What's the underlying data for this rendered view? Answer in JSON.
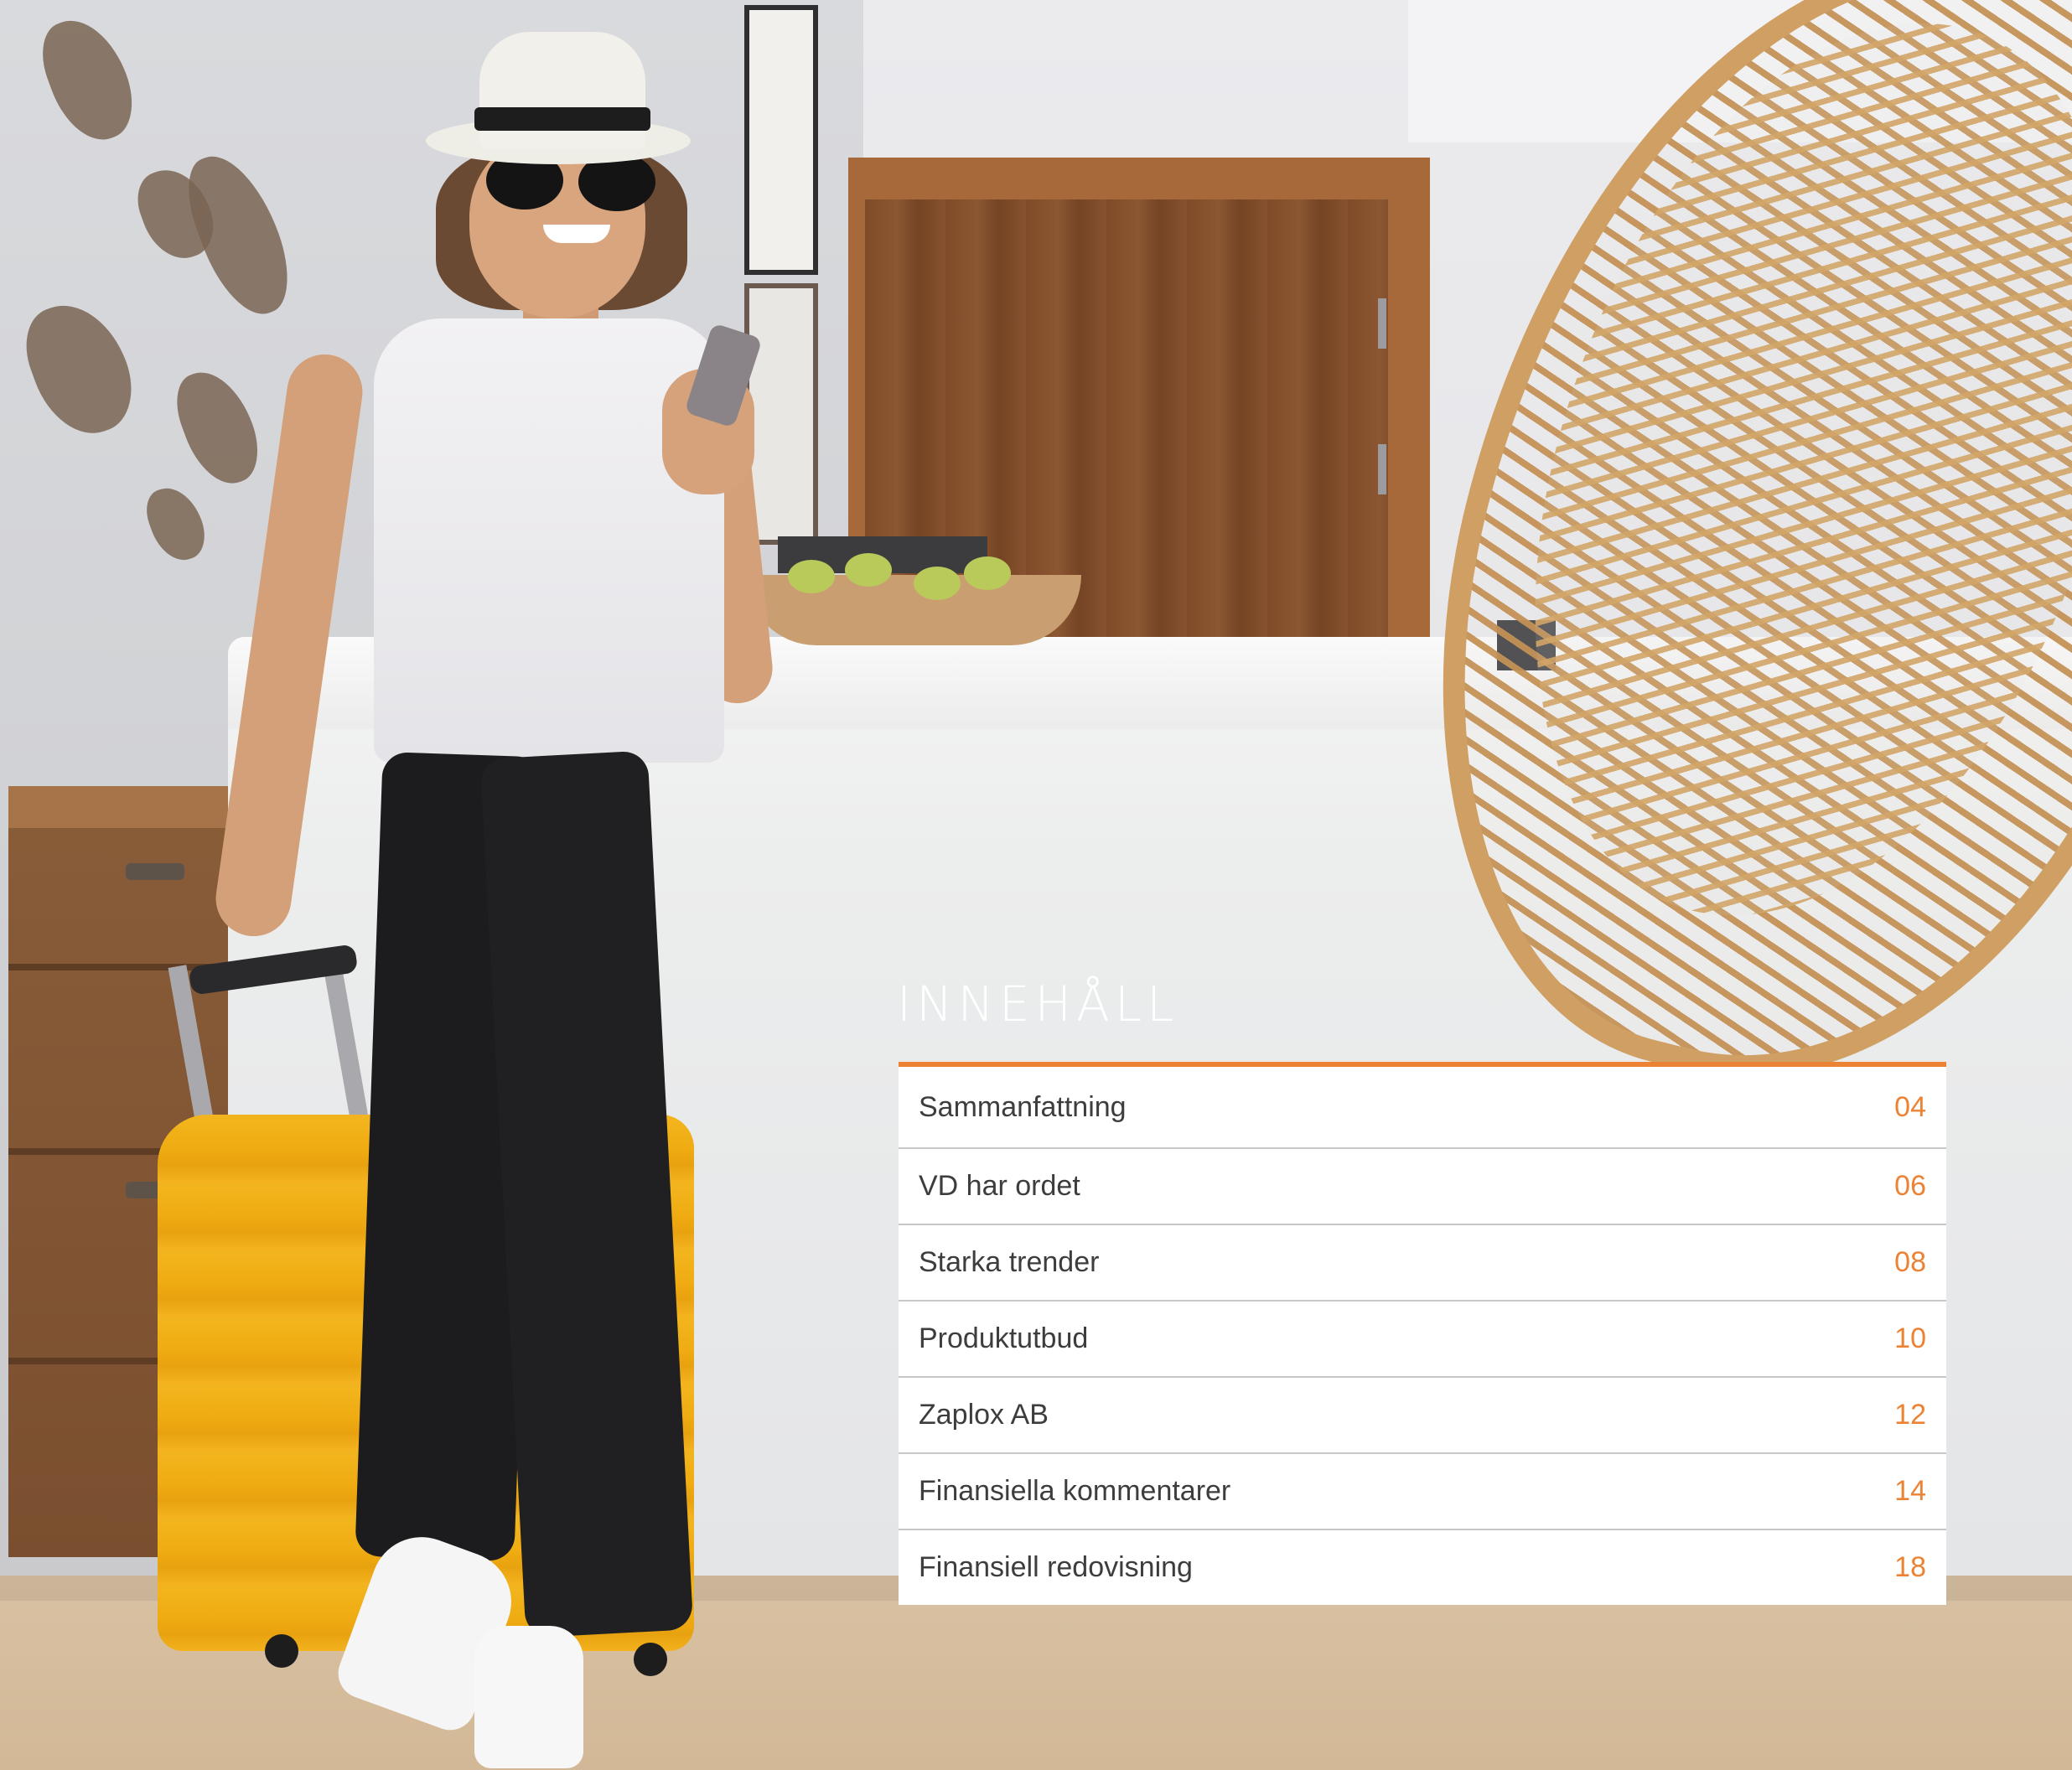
{
  "toc": {
    "heading": "INNEHÅLL",
    "accent_color": "#ec8234",
    "items": [
      {
        "label": "Sammanfattning",
        "page": "04"
      },
      {
        "label": "VD har ordet",
        "page": "06"
      },
      {
        "label": "Starka trender",
        "page": "08"
      },
      {
        "label": "Produktutbud",
        "page": "10"
      },
      {
        "label": "Zaplox AB",
        "page": "12"
      },
      {
        "label": "Finansiella kommentarer",
        "page": "14"
      },
      {
        "label": "Finansiell redovisning",
        "page": "18"
      }
    ]
  }
}
